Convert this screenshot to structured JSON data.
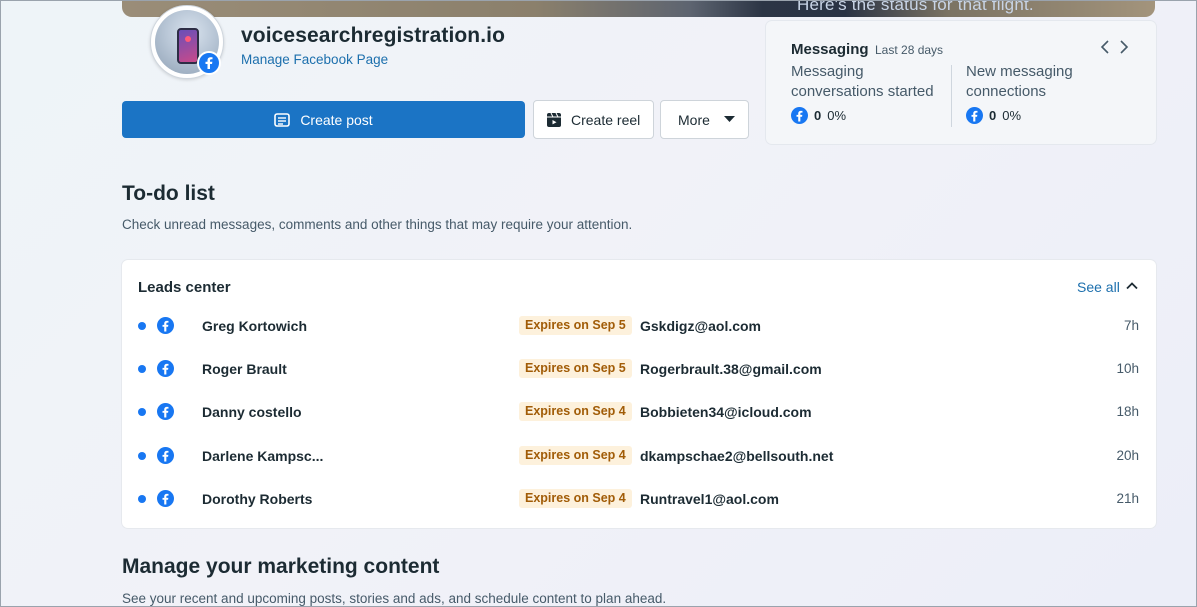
{
  "cover": {
    "caption": "Here's the status for that flight."
  },
  "page": {
    "name": "voicesearchregistration.io",
    "manage_link": "Manage Facebook Page"
  },
  "actions": {
    "create_post": "Create post",
    "create_reel": "Create reel",
    "more": "More"
  },
  "messaging": {
    "title": "Messaging",
    "period": "Last 28 days",
    "metrics": [
      {
        "label": "Messaging conversations started",
        "value": "0",
        "change": "0%"
      },
      {
        "label": "New messaging connections",
        "value": "0",
        "change": "0%"
      }
    ]
  },
  "todo": {
    "title": "To-do list",
    "subtitle": "Check unread messages, comments and other things that may require your attention."
  },
  "leads": {
    "title": "Leads center",
    "see_all": "See all",
    "rows": [
      {
        "name": "Greg Kortowich",
        "expires": "Expires on Sep 5",
        "email": "Gskdigz@aol.com",
        "time": "7h"
      },
      {
        "name": "Roger Brault",
        "expires": "Expires on Sep 5",
        "email": "Rogerbrault.38@gmail.com",
        "time": "10h"
      },
      {
        "name": "Danny costello",
        "expires": "Expires on Sep 4",
        "email": "Bobbieten34@icloud.com",
        "time": "18h"
      },
      {
        "name": "Darlene Kampsc...",
        "expires": "Expires on Sep 4",
        "email": "dkampschae2@bellsouth.net",
        "time": "20h"
      },
      {
        "name": "Dorothy Roberts",
        "expires": "Expires on Sep 4",
        "email": "Runtravel1@aol.com",
        "time": "21h"
      }
    ]
  },
  "marketing": {
    "title": "Manage your marketing content",
    "subtitle": "See your recent and upcoming posts, stories and ads, and schedule content to plan ahead."
  },
  "colors": {
    "primary": "#1b74c5",
    "facebook": "#1877f2",
    "link": "#1c6fad",
    "expires_bg": "#fdf1dc",
    "expires_text": "#a15c07"
  }
}
